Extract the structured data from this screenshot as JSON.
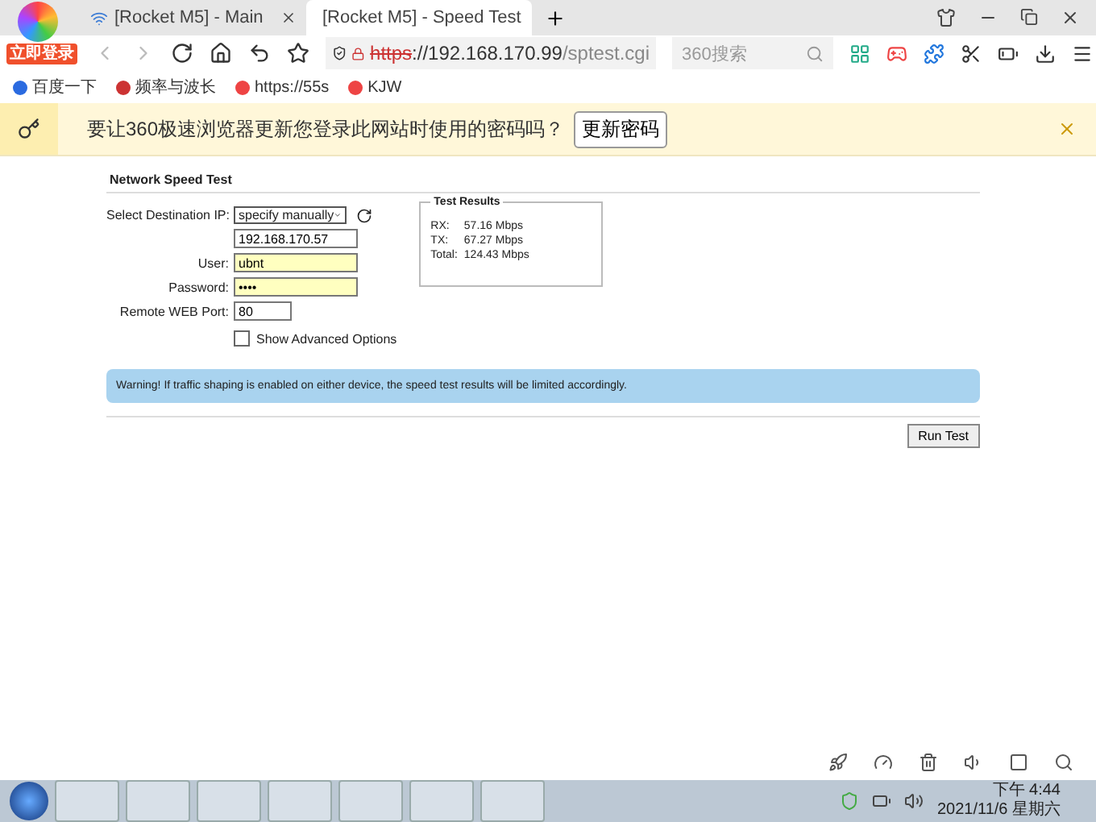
{
  "browser": {
    "login_badge": "立即登录",
    "tabs": [
      {
        "title": "[Rocket M5] - Main",
        "selected": false
      },
      {
        "title": "[Rocket M5] - Speed Test",
        "selected": true
      }
    ],
    "address": {
      "scheme": "https",
      "rest": "://192.168.170.99",
      "path": "/sptest.cgi"
    },
    "search": {
      "placeholder": "360搜索"
    },
    "bookmarks": [
      "百度一下",
      "频率与波长",
      "https://55s",
      "KJW"
    ]
  },
  "password_bar": {
    "message": "要让360极速浏览器更新您登录此网站时使用的密码吗？",
    "button": "更新密码"
  },
  "page": {
    "title": "Network Speed Test",
    "fields": [
      {
        "kind": "select",
        "label": "Select Destination IP:",
        "value": "specify manually"
      },
      {
        "kind": "text",
        "value": "192.168.170.57"
      },
      {
        "kind": "autofill",
        "label": "User:",
        "value": "ubnt"
      },
      {
        "kind": "autofill",
        "label": "Password:",
        "value": "••••"
      },
      {
        "kind": "short",
        "label": "Remote WEB Port:",
        "value": "80"
      }
    ],
    "advanced": {
      "label": "Show Advanced Options",
      "checked": false
    },
    "results": {
      "legend": "Test Results",
      "rows": [
        {
          "name": "RX:",
          "value": "57.16 Mbps"
        },
        {
          "name": "TX:",
          "value": "67.27 Mbps"
        },
        {
          "name": "Total:",
          "value": "124.43 Mbps"
        }
      ]
    },
    "warning": "Warning! If traffic shaping is enabled on either device, the speed test results will be limited accordingly.",
    "run_button": "Run Test"
  },
  "taskbar": {
    "time": "下午 4:44",
    "date": "2021/11/6 星期六"
  }
}
